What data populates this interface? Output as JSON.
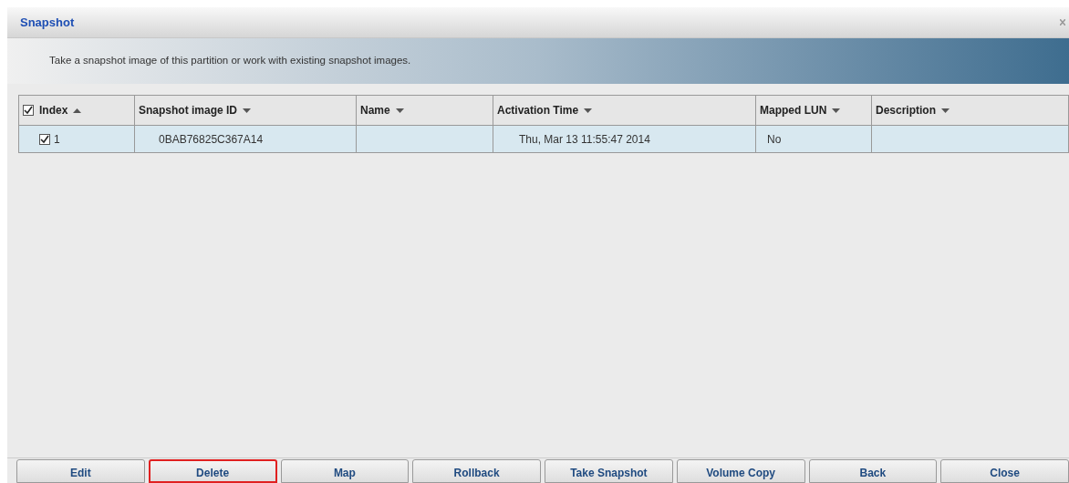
{
  "window": {
    "title": "Snapshot"
  },
  "banner": {
    "text": "Take a snapshot image of this partition or work with existing snapshot images."
  },
  "table": {
    "select_all_checked": true,
    "columns": [
      {
        "label": "Index",
        "ascending": true
      },
      {
        "label": "Snapshot image ID",
        "ascending": false
      },
      {
        "label": "Name",
        "ascending": false
      },
      {
        "label": "Activation Time",
        "ascending": false
      },
      {
        "label": "Mapped LUN",
        "ascending": false
      },
      {
        "label": "Description",
        "ascending": false
      }
    ],
    "rows": [
      {
        "checked": true,
        "selected": true,
        "cells": [
          "1",
          "0BAB76825C367A14",
          "",
          "Thu, Mar 13 11:55:47 2014",
          "No",
          ""
        ]
      }
    ]
  },
  "buttons": [
    {
      "label": "Edit",
      "highlighted": false
    },
    {
      "label": "Delete",
      "highlighted": true
    },
    {
      "label": "Map",
      "highlighted": false
    },
    {
      "label": "Rollback",
      "highlighted": false
    },
    {
      "label": "Take Snapshot",
      "highlighted": false
    },
    {
      "label": "Volume Copy",
      "highlighted": false
    },
    {
      "label": "Back",
      "highlighted": false
    },
    {
      "label": "Close",
      "highlighted": false
    }
  ]
}
